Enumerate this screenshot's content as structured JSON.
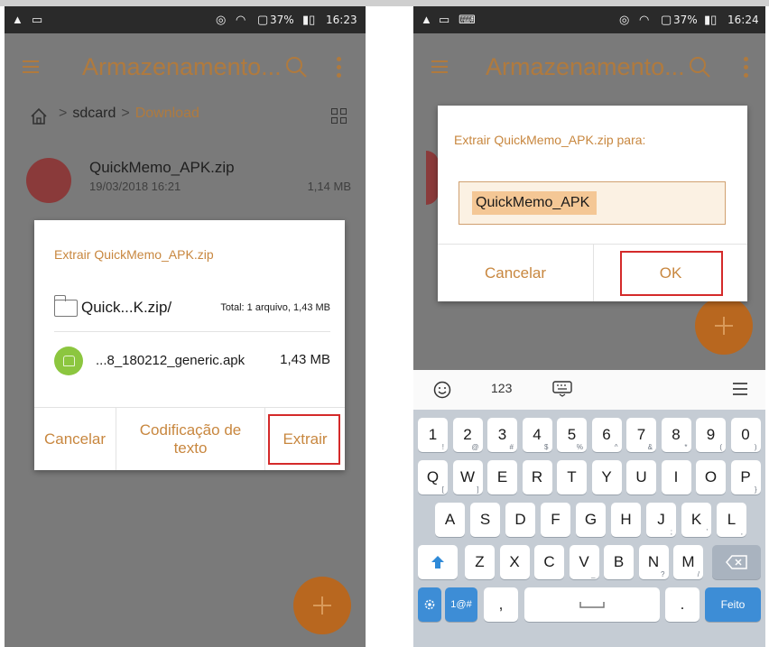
{
  "left_screen": {
    "status": {
      "time": "16:23",
      "battery": "37%"
    },
    "appbar": {
      "title": "Armazenamento..."
    },
    "breadcrumb": {
      "root": "sdcard",
      "current": "Download",
      "separator": ">"
    },
    "file": {
      "name": "QuickMemo_APK.zip",
      "date": "19/03/2018 16:21",
      "size": "1,14 MB"
    },
    "dialog": {
      "title": "Extrair QuickMemo_APK.zip",
      "zip_name": "Quick...K.zip/",
      "zip_total": "Total: 1 arquivo, 1,43 MB",
      "apk_name": "...8_180212_generic.apk",
      "apk_size": "1,43 MB",
      "cancel_label": "Cancelar",
      "encoding_label_1": "Codificação de",
      "encoding_label_2": "texto",
      "extract_label": "Extrair"
    }
  },
  "right_screen": {
    "status": {
      "time": "16:24",
      "battery": "37%"
    },
    "appbar": {
      "title": "Armazenamento..."
    },
    "dialog": {
      "title": "Extrair QuickMemo_APK.zip para:",
      "input_value": "QuickMemo_APK",
      "cancel_label": "Cancelar",
      "ok_label": "OK"
    },
    "keyboard": {
      "numbers_tab": "123",
      "row1": [
        {
          "k": "1",
          "a": "!"
        },
        {
          "k": "2",
          "a": "@"
        },
        {
          "k": "3",
          "a": "#"
        },
        {
          "k": "4",
          "a": "$"
        },
        {
          "k": "5",
          "a": "%"
        },
        {
          "k": "6",
          "a": "^"
        },
        {
          "k": "7",
          "a": "&"
        },
        {
          "k": "8",
          "a": "*"
        },
        {
          "k": "9",
          "a": "("
        },
        {
          "k": "0",
          "a": ")"
        }
      ],
      "row2": [
        {
          "k": "Q",
          "a": "["
        },
        {
          "k": "W",
          "a": "]"
        },
        {
          "k": "E",
          "a": ""
        },
        {
          "k": "R",
          "a": ""
        },
        {
          "k": "T",
          "a": ""
        },
        {
          "k": "Y",
          "a": ""
        },
        {
          "k": "U",
          "a": ""
        },
        {
          "k": "I",
          "a": ""
        },
        {
          "k": "O",
          "a": ""
        },
        {
          "k": "P",
          "a": "}"
        }
      ],
      "row3": [
        {
          "k": "A",
          "a": ""
        },
        {
          "k": "S",
          "a": ""
        },
        {
          "k": "D",
          "a": ""
        },
        {
          "k": "F",
          "a": ""
        },
        {
          "k": "G",
          "a": ""
        },
        {
          "k": "H",
          "a": ""
        },
        {
          "k": "J",
          "a": ";"
        },
        {
          "k": "K",
          "a": "'"
        },
        {
          "k": "L",
          "a": ","
        }
      ],
      "row4": [
        {
          "k": "Z",
          "a": ""
        },
        {
          "k": "X",
          "a": ""
        },
        {
          "k": "C",
          "a": ""
        },
        {
          "k": "V",
          "a": "_"
        },
        {
          "k": "B",
          "a": ""
        },
        {
          "k": "N",
          "a": "?"
        },
        {
          "k": "M",
          "a": "/"
        }
      ],
      "symbols_label": "1@#",
      "comma_label": ",",
      "period_label": ".",
      "done_label": "Feito"
    }
  },
  "colors": {
    "accent": "#c8873f",
    "highlight_box": "#d42a2a",
    "keyboard_blue": "#3d8dd6",
    "apk_green": "#8cc63f"
  }
}
